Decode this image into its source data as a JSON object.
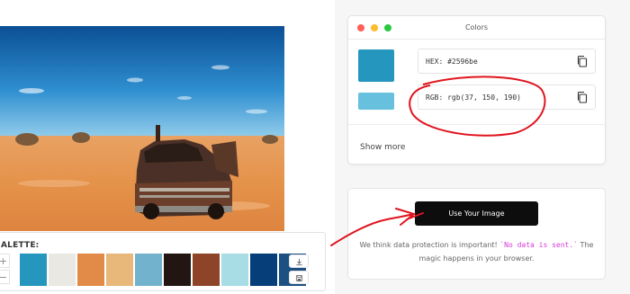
{
  "palette": {
    "label": "ALETTE:",
    "add_symbol": "+",
    "remove_symbol": "−",
    "swatches": [
      "#2596be",
      "#eae8e2",
      "#e28a48",
      "#e8b77a",
      "#72b2cc",
      "#231511",
      "#8e4428",
      "#a8dde6",
      "#063e7a",
      "#1c4f82"
    ]
  },
  "colors_window": {
    "title": "Colors",
    "hex_value": "HEX: #2596be",
    "rgb_value": "RGB: rgb(37, 150, 190)",
    "show_more": "Show more",
    "main_color": "#2596be",
    "light_color": "#66c0de"
  },
  "use_image": {
    "button_label": "Use Your Image",
    "privacy_pre": "We think data protection is important! ",
    "privacy_code": "`No data is sent.`",
    "privacy_post": " The magic happens in your browser."
  },
  "colors": {
    "annotation_red": "#e0141e",
    "accent_pink": "#d63ad6"
  }
}
